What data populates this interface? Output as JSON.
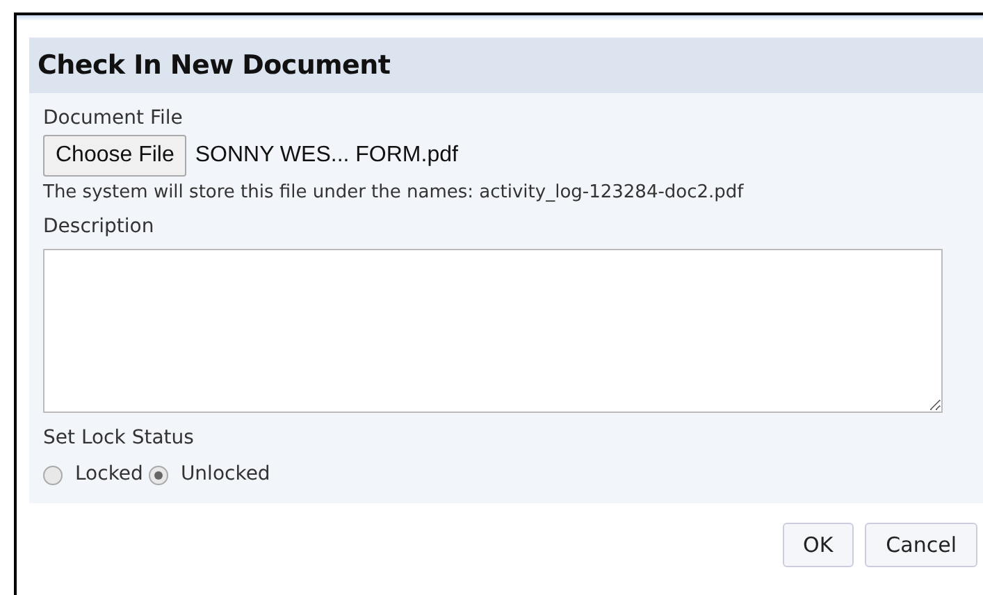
{
  "dialog": {
    "title": "Check In New Document"
  },
  "document_file": {
    "label": "Document File",
    "button": "Choose File",
    "file_name": "SONNY WES... FORM.pdf",
    "note": "The system will store this file under the names: activity_log-123284-doc2.pdf"
  },
  "description": {
    "label": "Description"
  },
  "lock_status": {
    "label": "Set Lock Status",
    "options": [
      {
        "label": "Locked",
        "selected": false
      },
      {
        "label": "Unlocked",
        "selected": true
      }
    ]
  },
  "buttons": [
    "OK",
    "Cancel"
  ]
}
